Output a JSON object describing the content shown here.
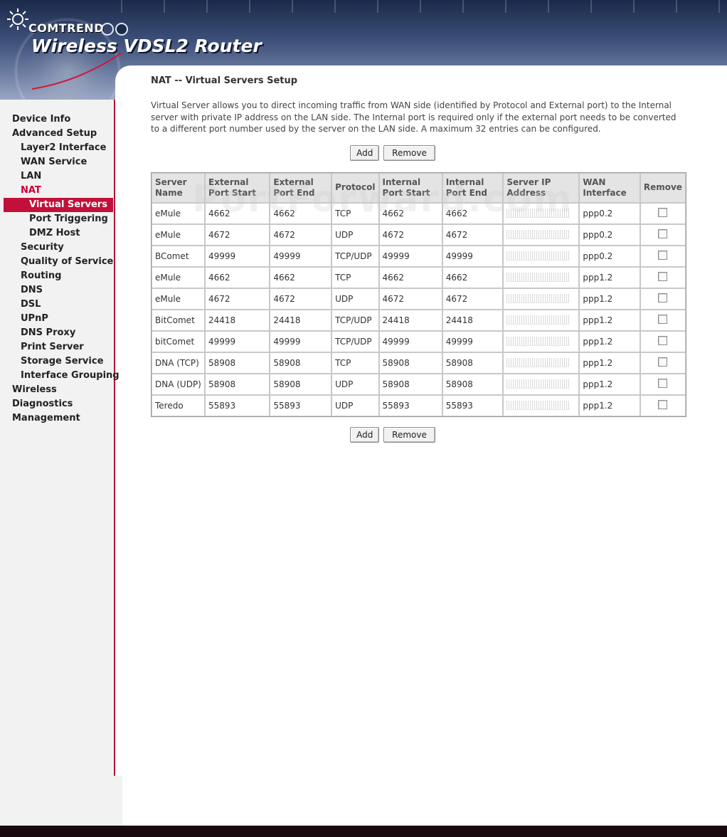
{
  "header": {
    "brand": "COMTREND",
    "product_title": "Wireless VDSL2 Router"
  },
  "sidebar": {
    "items": [
      {
        "label": "Device Info",
        "level": 0
      },
      {
        "label": "Advanced Setup",
        "level": 0
      },
      {
        "label": "Layer2 Interface",
        "level": 1
      },
      {
        "label": "WAN Service",
        "level": 1
      },
      {
        "label": "LAN",
        "level": 1
      },
      {
        "label": "NAT",
        "level": 1
      },
      {
        "label": "Virtual Servers",
        "level": 2
      },
      {
        "label": "Port Triggering",
        "level": 2
      },
      {
        "label": "DMZ Host",
        "level": 2
      },
      {
        "label": "Security",
        "level": 1
      },
      {
        "label": "Quality of Service",
        "level": 1
      },
      {
        "label": "Routing",
        "level": 1
      },
      {
        "label": "DNS",
        "level": 1
      },
      {
        "label": "DSL",
        "level": 1
      },
      {
        "label": "UPnP",
        "level": 1
      },
      {
        "label": "DNS Proxy",
        "level": 1
      },
      {
        "label": "Print Server",
        "level": 1
      },
      {
        "label": "Storage Service",
        "level": 1
      },
      {
        "label": "Interface Grouping",
        "level": 1
      },
      {
        "label": "Wireless",
        "level": 0
      },
      {
        "label": "Diagnostics",
        "level": 0
      },
      {
        "label": "Management",
        "level": 0
      }
    ]
  },
  "main": {
    "title": "NAT -- Virtual Servers Setup",
    "description": "Virtual Server allows you to direct incoming traffic from WAN side (identified by Protocol and External port) to the Internal server with private IP address on the LAN side. The Internal port is required only if the external port needs to be converted to a different port number used by the server on the LAN side. A maximum 32 entries can be configured.",
    "add_label": "Add",
    "remove_label": "Remove",
    "table": {
      "headers": [
        "Server Name",
        "External Port Start",
        "External Port End",
        "Protocol",
        "Internal Port Start",
        "Internal Port End",
        "Server IP Address",
        "WAN Interface",
        "Remove"
      ],
      "rows": [
        {
          "name": "eMule",
          "ext_start": "4662",
          "ext_end": "4662",
          "protocol": "TCP",
          "int_start": "4662",
          "int_end": "4662",
          "wan": "ppp0.2"
        },
        {
          "name": "eMule",
          "ext_start": "4672",
          "ext_end": "4672",
          "protocol": "UDP",
          "int_start": "4672",
          "int_end": "4672",
          "wan": "ppp0.2"
        },
        {
          "name": "BComet",
          "ext_start": "49999",
          "ext_end": "49999",
          "protocol": "TCP/UDP",
          "int_start": "49999",
          "int_end": "49999",
          "wan": "ppp0.2"
        },
        {
          "name": "eMule",
          "ext_start": "4662",
          "ext_end": "4662",
          "protocol": "TCP",
          "int_start": "4662",
          "int_end": "4662",
          "wan": "ppp1.2"
        },
        {
          "name": "eMule",
          "ext_start": "4672",
          "ext_end": "4672",
          "protocol": "UDP",
          "int_start": "4672",
          "int_end": "4672",
          "wan": "ppp1.2"
        },
        {
          "name": "BitComet",
          "ext_start": "24418",
          "ext_end": "24418",
          "protocol": "TCP/UDP",
          "int_start": "24418",
          "int_end": "24418",
          "wan": "ppp1.2"
        },
        {
          "name": "bitComet",
          "ext_start": "49999",
          "ext_end": "49999",
          "protocol": "TCP/UDP",
          "int_start": "49999",
          "int_end": "49999",
          "wan": "ppp1.2"
        },
        {
          "name": "DNA (TCP)",
          "ext_start": "58908",
          "ext_end": "58908",
          "protocol": "TCP",
          "int_start": "58908",
          "int_end": "58908",
          "wan": "ppp1.2"
        },
        {
          "name": "DNA (UDP)",
          "ext_start": "58908",
          "ext_end": "58908",
          "protocol": "UDP",
          "int_start": "58908",
          "int_end": "58908",
          "wan": "ppp1.2"
        },
        {
          "name": "Teredo",
          "ext_start": "55893",
          "ext_end": "55893",
          "protocol": "UDP",
          "int_start": "55893",
          "int_end": "55893",
          "wan": "ppp1.2"
        }
      ]
    }
  },
  "watermark": "PortForward.com",
  "colors": {
    "accent_red": "#c2103a",
    "banner_dark": "#1b2a4a",
    "sidebar_bg": "#f2f2f2"
  }
}
